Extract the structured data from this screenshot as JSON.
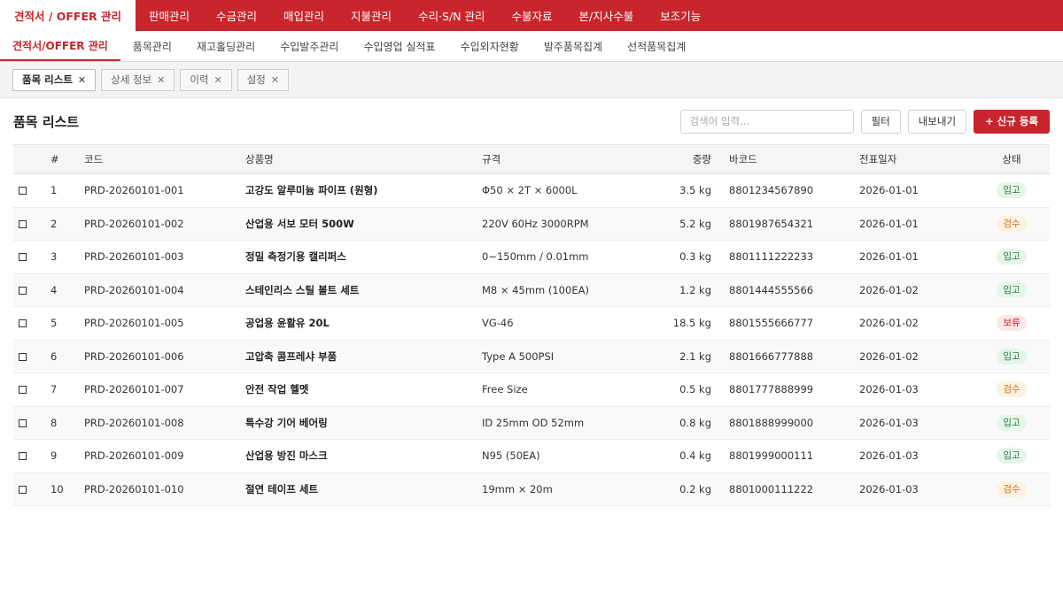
{
  "topnav": {
    "items": [
      "견적서 / OFFER 관리",
      "판매관리",
      "수금관리",
      "매입관리",
      "지불관리",
      "수리·S/N 관리",
      "수불자료",
      "본/지사수불",
      "보조기능"
    ]
  },
  "subnav": {
    "items": [
      "견적서/OFFER 관리",
      "품목관리",
      "재고홀딩관리",
      "수입발주관리",
      "수입영업 실적표",
      "수입외자현황",
      "발주품목집계",
      "선적품목집계"
    ]
  },
  "tabs": {
    "items": [
      "품목 리스트",
      "상세 정보",
      "이력",
      "설정"
    ],
    "close_glyph": "✕"
  },
  "header": {
    "title": "품목 리스트",
    "search_placeholder": "검색어 입력...",
    "filter_label": "필터",
    "export_label": "내보내기",
    "new_label": "+ 신규 등록"
  },
  "colors": {
    "brand": "#c9252c"
  },
  "table": {
    "columns": {
      "num": "#",
      "code": "코드",
      "name": "상품명",
      "spec": "규격",
      "weight": "중량",
      "barcode": "바코드",
      "date": "전표일자",
      "status": "상태"
    },
    "rows": [
      {
        "num": "1",
        "code": "PRD-20260101-001",
        "name": "고강도 알루미늄 파이프 (원형)",
        "spec": "Φ50 × 2T × 6000L",
        "weight": "3.5 kg",
        "barcode": "8801234567890",
        "date": "2026-01-01",
        "status": "입고",
        "status_type": "in"
      },
      {
        "num": "2",
        "code": "PRD-20260101-002",
        "name": "산업용 서보 모터 500W",
        "spec": "220V 60Hz 3000RPM",
        "weight": "5.2 kg",
        "barcode": "8801987654321",
        "date": "2026-01-01",
        "status": "검수",
        "status_type": "insp"
      },
      {
        "num": "3",
        "code": "PRD-20260101-003",
        "name": "정밀 측정기용 캘리퍼스",
        "spec": "0~150mm / 0.01mm",
        "weight": "0.3 kg",
        "barcode": "8801111222233",
        "date": "2026-01-01",
        "status": "입고",
        "status_type": "in"
      },
      {
        "num": "4",
        "code": "PRD-20260101-004",
        "name": "스테인리스 스틸 볼트 세트",
        "spec": "M8 × 45mm (100EA)",
        "weight": "1.2 kg",
        "barcode": "8801444555566",
        "date": "2026-01-02",
        "status": "입고",
        "status_type": "in"
      },
      {
        "num": "5",
        "code": "PRD-20260101-005",
        "name": "공업용 윤활유 20L",
        "spec": "VG-46",
        "weight": "18.5 kg",
        "barcode": "8801555666777",
        "date": "2026-01-02",
        "status": "보류",
        "status_type": "hold"
      },
      {
        "num": "6",
        "code": "PRD-20260101-006",
        "name": "고압축 콤프레샤 부품",
        "spec": "Type A 500PSI",
        "weight": "2.1 kg",
        "barcode": "8801666777888",
        "date": "2026-01-02",
        "status": "입고",
        "status_type": "in"
      },
      {
        "num": "7",
        "code": "PRD-20260101-007",
        "name": "안전 작업 헬멧",
        "spec": "Free Size",
        "weight": "0.5 kg",
        "barcode": "8801777888999",
        "date": "2026-01-03",
        "status": "검수",
        "status_type": "insp"
      },
      {
        "num": "8",
        "code": "PRD-20260101-008",
        "name": "특수강 기어 베어링",
        "spec": "ID 25mm OD 52mm",
        "weight": "0.8 kg",
        "barcode": "8801888999000",
        "date": "2026-01-03",
        "status": "입고",
        "status_type": "in"
      },
      {
        "num": "9",
        "code": "PRD-20260101-009",
        "name": "산업용 방진 마스크",
        "spec": "N95 (50EA)",
        "weight": "0.4 kg",
        "barcode": "8801999000111",
        "date": "2026-01-03",
        "status": "입고",
        "status_type": "in"
      },
      {
        "num": "10",
        "code": "PRD-20260101-010",
        "name": "절연 테이프 세트",
        "spec": "19mm × 20m",
        "weight": "0.2 kg",
        "barcode": "8801000111222",
        "date": "2026-01-03",
        "status": "검수",
        "status_type": "insp"
      }
    ]
  }
}
